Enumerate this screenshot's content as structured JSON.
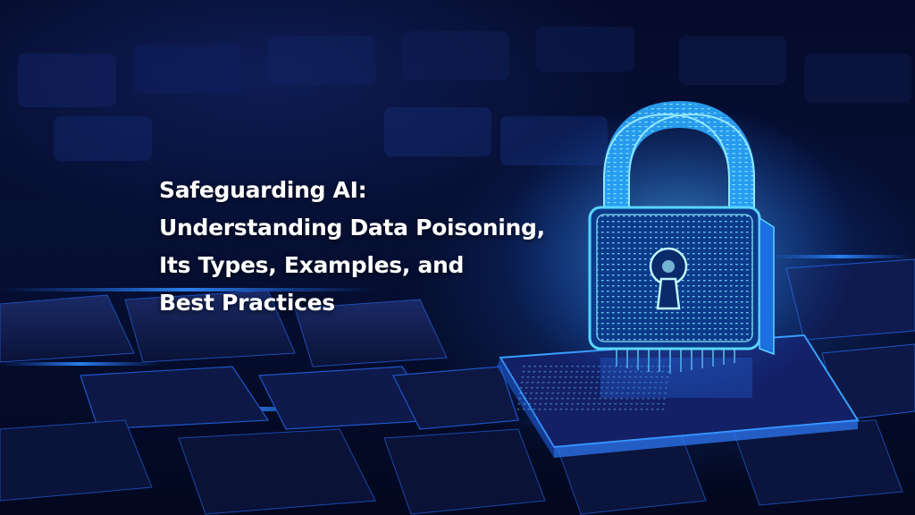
{
  "headline": {
    "line1": "Safeguarding AI:",
    "line2": "Understanding Data Poisoning,",
    "line3": "Its Types, Examples, and",
    "line4": "Best Practices"
  },
  "colors": {
    "background": "#050b2a",
    "accent_glow": "#3ab8ff",
    "text": "#ffffff"
  },
  "illustration": {
    "icon": "padlock-icon",
    "scene": "circuit-board-keys"
  }
}
